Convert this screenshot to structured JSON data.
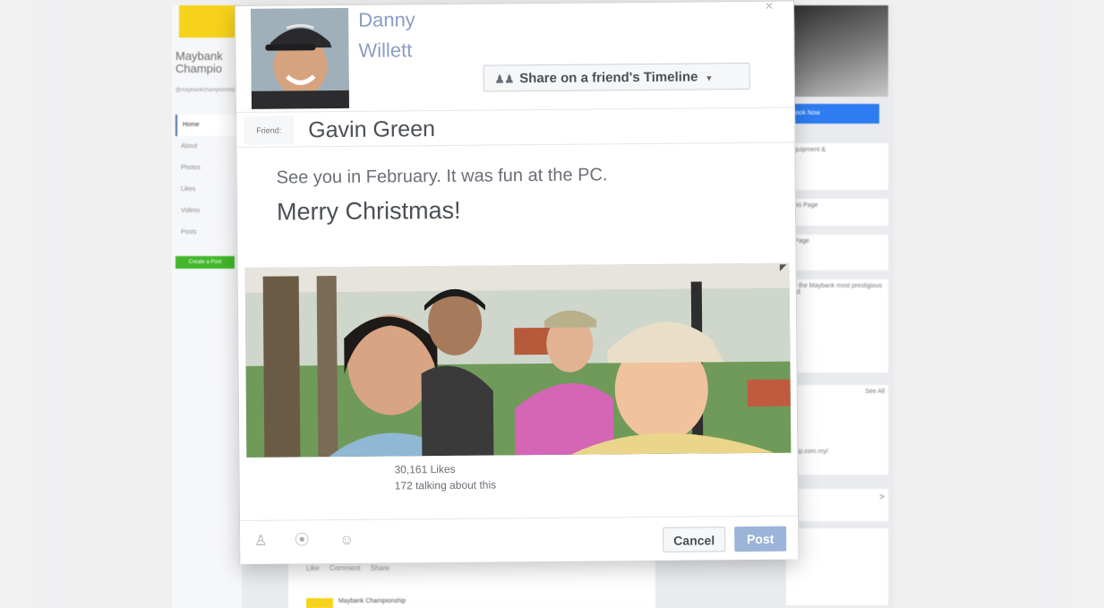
{
  "background_page": {
    "page_name": "Maybank Champio",
    "handle": "@maybankchampionship",
    "nav": [
      "Home",
      "About",
      "Photos",
      "Likes",
      "Videos",
      "Posts"
    ],
    "create_button": "Create a Post",
    "book_button": "Book Now",
    "right_cards": [
      "Equipment &",
      "This Page",
      "s Page",
      "for the Maybank most prestigious and",
      "See All",
      "iship.com.my/",
      ">"
    ],
    "actions": [
      "Like",
      "Comment",
      "Share"
    ],
    "post_author": "Maybank Championship"
  },
  "dialog": {
    "profile_name_line1": "Danny",
    "profile_name_line2": "Willett",
    "share_target_label": "Share on a friend's Timeline",
    "friend_label": "Friend:",
    "friend_name": "Gavin Green",
    "message_line1": "See you in February. It was fun at the PC.",
    "message_line2": "Merry Christmas!",
    "likes_text": "30,161 Likes",
    "talking_text": "172 talking about this",
    "cancel_label": "Cancel",
    "post_label": "Post",
    "footer_icons": [
      "tag-friends-icon",
      "location-pin-icon",
      "emoji-icon"
    ]
  },
  "colors": {
    "accent": "#9cb4d8",
    "brand_yellow": "#f7d21b",
    "book_blue": "#2d7cf1",
    "create_green": "#42b72a"
  }
}
